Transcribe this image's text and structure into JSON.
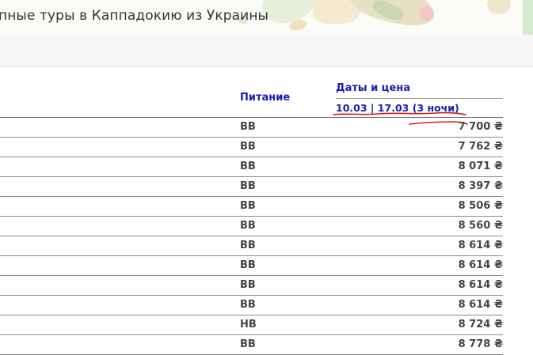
{
  "page": {
    "title": "пные туры в Каппадокию из Украины"
  },
  "table": {
    "headers": {
      "meal": "Питание",
      "dates": "Даты и цена",
      "range": "10.03 | 17.03 (3 ночи)"
    },
    "rows": [
      {
        "meal": "BB",
        "price": "7 700 ₴"
      },
      {
        "meal": "BB",
        "price": "7 762 ₴"
      },
      {
        "meal": "BB",
        "price": "8 071 ₴"
      },
      {
        "meal": "BB",
        "price": "8 397 ₴"
      },
      {
        "meal": "BB",
        "price": "8 506 ₴"
      },
      {
        "meal": "BB",
        "price": "8 560 ₴"
      },
      {
        "meal": "BB",
        "price": "8 614 ₴"
      },
      {
        "meal": "BB",
        "price": "8 614 ₴"
      },
      {
        "meal": "BB",
        "price": "8 614 ₴"
      },
      {
        "meal": "BB",
        "price": "8 614 ₴"
      },
      {
        "meal": "HB",
        "price": "8 724 ₴"
      },
      {
        "meal": "BB",
        "price": "8 778 ₴"
      }
    ]
  },
  "colors": {
    "header_text": "#1a1ab8",
    "cell_text": "#444444",
    "annotation": "#e01010"
  }
}
